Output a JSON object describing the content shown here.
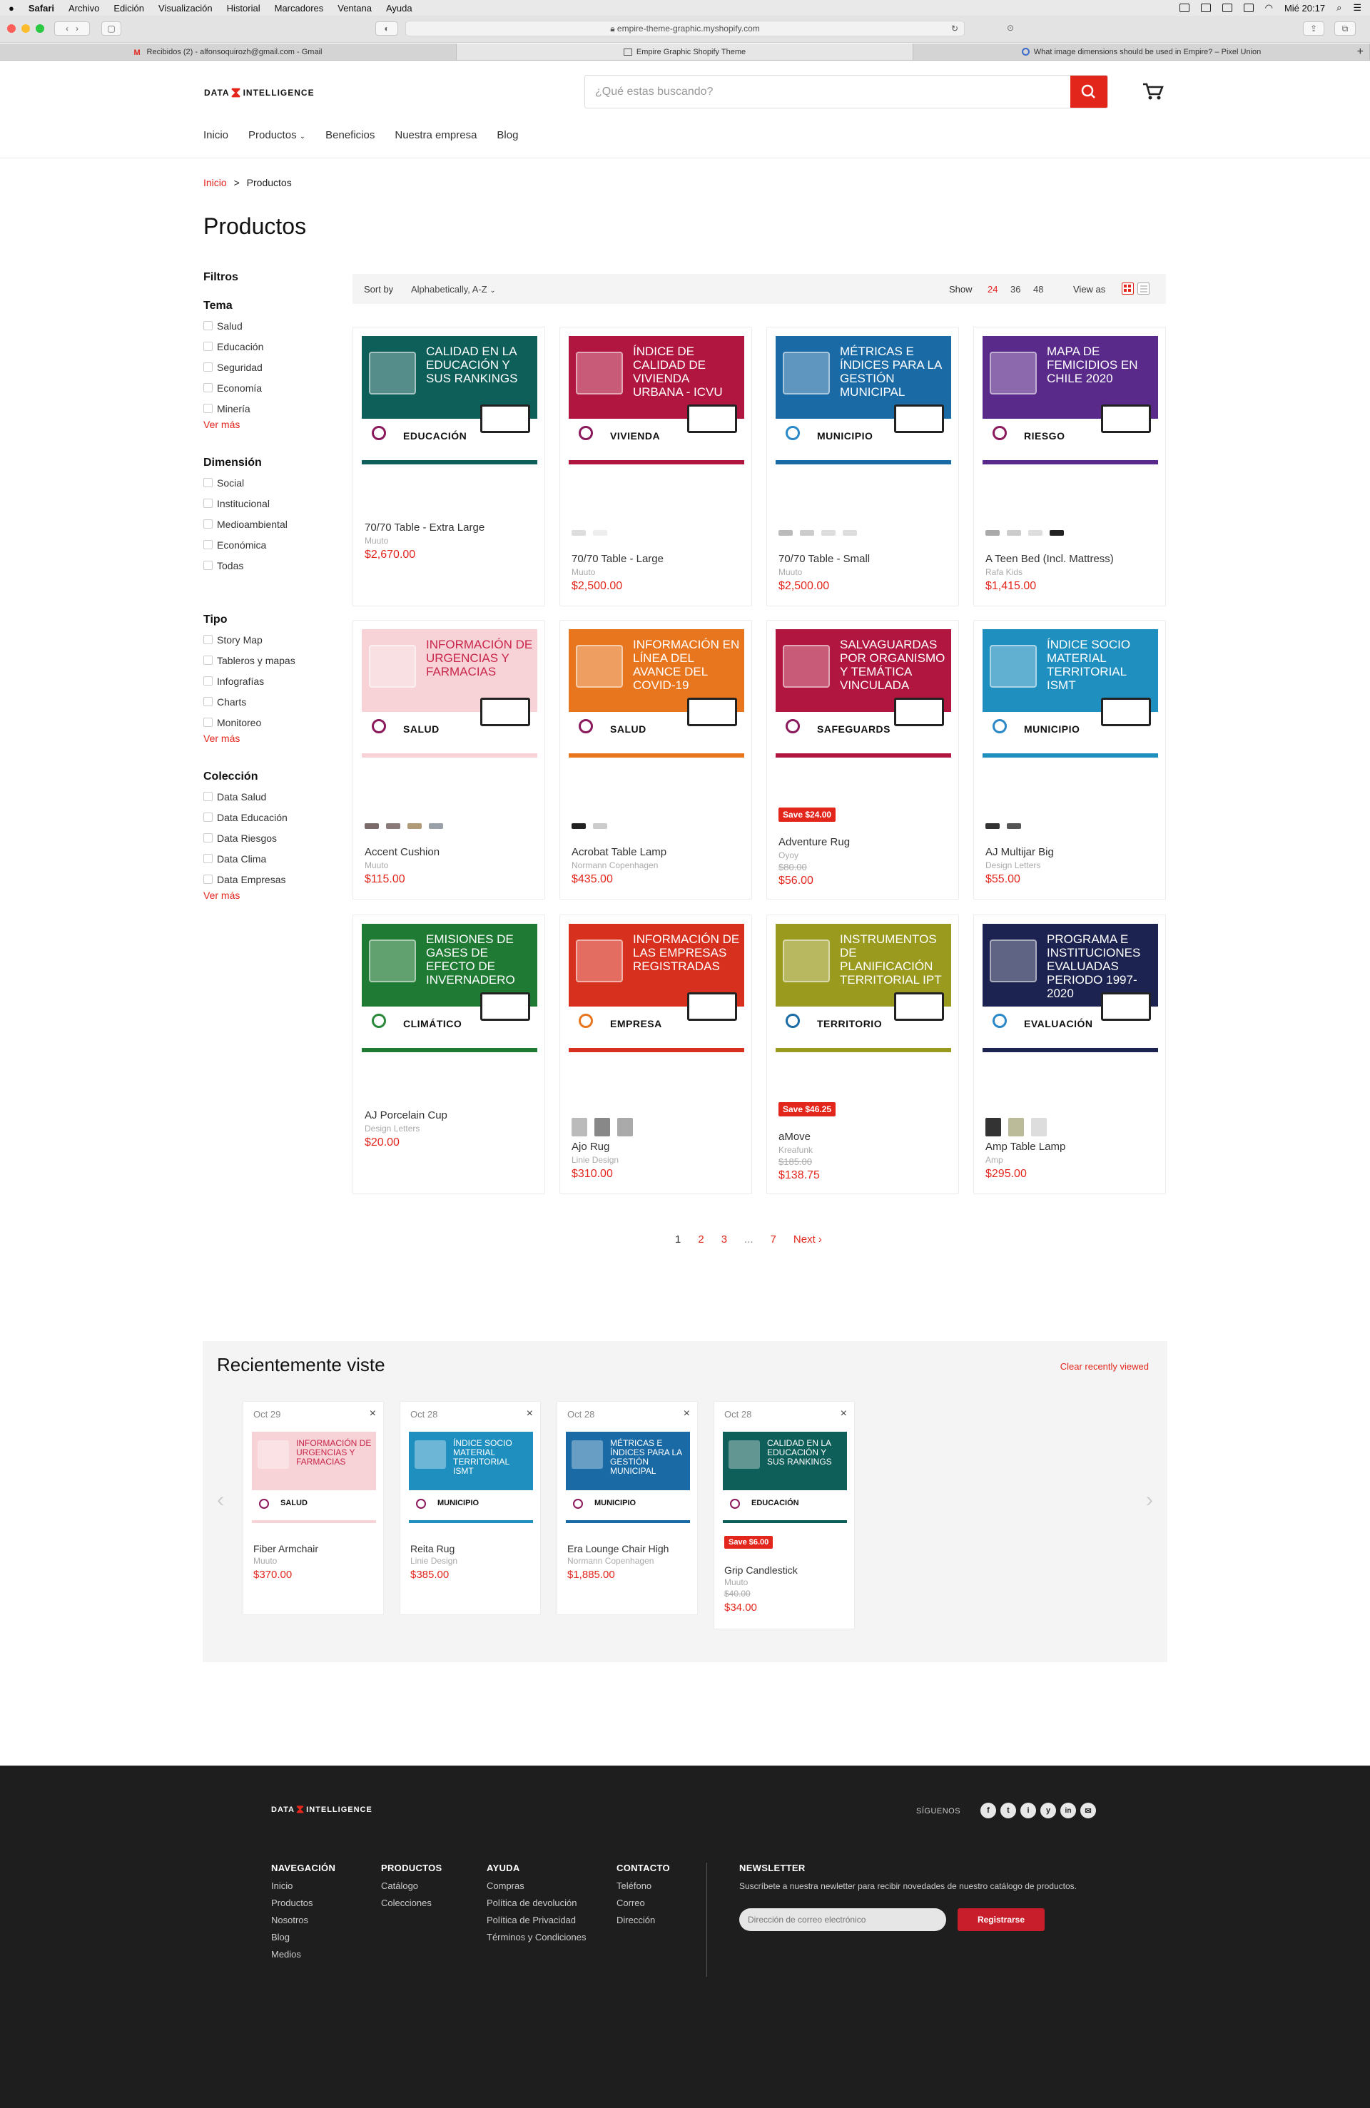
{
  "menubar": {
    "apple": "",
    "items": [
      "Safari",
      "Archivo",
      "Edición",
      "Visualización",
      "Historial",
      "Marcadores",
      "Ventana",
      "Ayuda"
    ],
    "clock": "Mié 20:17"
  },
  "browser": {
    "url": "empire-theme-graphic.myshopify.com",
    "tabs": [
      {
        "label": "Recibidos (2) - alfonsoquirozh@gmail.com - Gmail",
        "icon": "gmail-icon"
      },
      {
        "label": "Empire Graphic Shopify Theme",
        "icon": "shopify-icon"
      },
      {
        "label": "What image dimensions should be used in Empire? – Pixel Union",
        "icon": "pixelunion-icon"
      }
    ]
  },
  "header": {
    "logo_left": "DATA",
    "logo_right": "INTELLIGENCE",
    "search_placeholder": "¿Qué estas buscando?",
    "nav": [
      "Inicio",
      "Productos",
      "Beneficios",
      "Nuestra empresa",
      "Blog"
    ]
  },
  "breadcrumb": {
    "home": "Inicio",
    "sep": ">",
    "current": "Productos"
  },
  "page_title": "Productos",
  "filters": {
    "title": "Filtros",
    "groups": [
      {
        "title": "Tema",
        "items": [
          "Salud",
          "Educación",
          "Seguridad",
          "Economía",
          "Minería"
        ],
        "more": "Ver más"
      },
      {
        "title": "Dimensión",
        "items": [
          "Social",
          "Institucional",
          "Medioambiental",
          "Económica",
          "Todas"
        ],
        "more": ""
      },
      {
        "title": "Tipo",
        "items": [
          "Story Map",
          "Tableros y mapas",
          "Infografías",
          "Charts",
          "Monitoreo"
        ],
        "more": "Ver más"
      },
      {
        "title": "Colección",
        "items": [
          "Data Salud",
          "Data Educación",
          "Data Riesgos",
          "Data Clima",
          "Data Empresas"
        ],
        "more": "Ver más"
      }
    ]
  },
  "sortbar": {
    "sort_label": "Sort by",
    "sort_value": "Alphabetically, A-Z",
    "show_label": "Show",
    "show_options": [
      "24",
      "36",
      "48"
    ],
    "view_label": "View as"
  },
  "products": [
    {
      "title": "Calidad en la educación y sus rankings",
      "category": "EDUCACIÓN",
      "color": "#0e5e5a",
      "accent": "#8a1a5c",
      "name": "70/70 Table - Extra Large",
      "vendor": "Muuto",
      "price": "$2,670.00",
      "compare": "",
      "save": "",
      "swatches": []
    },
    {
      "title": "Índice de calidad de vivienda urbana - ICVU",
      "category": "VIVIENDA",
      "color": "#b0163f",
      "accent": "#8a1a5c",
      "name": "70/70 Table - Large",
      "vendor": "Muuto",
      "price": "$2,500.00",
      "compare": "",
      "save": "",
      "swatches": [
        "#ddd",
        "#eee"
      ]
    },
    {
      "title": "Métricas e índices para la gestión municipal",
      "category": "MUNICIPIO",
      "color": "#1a6aa5",
      "accent": "#2a88c8",
      "name": "70/70 Table - Small",
      "vendor": "Muuto",
      "price": "$2,500.00",
      "compare": "",
      "save": "",
      "swatches": [
        "#bbb",
        "#ccc",
        "#ddd",
        "#ddd"
      ]
    },
    {
      "title": "Mapa de femicidios en Chile 2020",
      "category": "RIESGO",
      "color": "#5a2a8a",
      "accent": "#8a1a5c",
      "name": "A Teen Bed (Incl. Mattress)",
      "vendor": "Rafa Kids",
      "price": "$1,415.00",
      "compare": "",
      "save": "",
      "swatches": [
        "#aaa",
        "#ccc",
        "#ddd",
        "#222"
      ]
    },
    {
      "title": "Información de urgencias y farmacias",
      "category": "SALUD",
      "color": "#f7d3d8",
      "accent": "#8a1a5c",
      "name": "Accent Cushion",
      "vendor": "Muuto",
      "price": "$115.00",
      "compare": "",
      "save": "",
      "swatches": [
        "#7a6a6a",
        "#8a7a7a",
        "#b09a78",
        "#9aa0a8"
      ]
    },
    {
      "title": "Información en línea del avance del COVID-19",
      "category": "SALUD",
      "color": "#e8761e",
      "accent": "#8a1a5c",
      "name": "Acrobat Table Lamp",
      "vendor": "Normann Copenhagen",
      "price": "$435.00",
      "compare": "",
      "save": "",
      "swatches": [
        "#222",
        "#ccc"
      ]
    },
    {
      "title": "Salvaguardas por organismo y temática vinculada",
      "category": "SAFEGUARDS",
      "color": "#b0163f",
      "accent": "#8a1a5c",
      "name": "Adventure Rug",
      "vendor": "Oyoy",
      "price": "$56.00",
      "compare": "$80.00",
      "save": "Save $24.00",
      "swatches": []
    },
    {
      "title": "Índice socio material territorial ISMT",
      "category": "MUNICIPIO",
      "color": "#1f8fbf",
      "accent": "#2a88c8",
      "name": "AJ Multijar Big",
      "vendor": "Design Letters",
      "price": "$55.00",
      "compare": "",
      "save": "",
      "swatches": [
        "#333",
        "#555"
      ]
    },
    {
      "title": "Emisiones de gases de efecto de invernadero",
      "category": "CLIMÁTICO",
      "color": "#1f7a33",
      "accent": "#2a8a3a",
      "name": "AJ Porcelain Cup",
      "vendor": "Design Letters",
      "price": "$20.00",
      "compare": "",
      "save": "",
      "swatches": []
    },
    {
      "title": "Información de las empresas registradas",
      "category": "EMPRESA",
      "color": "#d8301e",
      "accent": "#e8761e",
      "name": "Ajo Rug",
      "vendor": "Linie Design",
      "price": "$310.00",
      "compare": "",
      "save": "",
      "swatches": [
        "#bbb",
        "#888",
        "#aaa"
      ]
    },
    {
      "title": "Instrumentos de planificación territorial IPT",
      "category": "TERRITORIO",
      "color": "#9a9a1e",
      "accent": "#1a6aa5",
      "name": "aMove",
      "vendor": "Kreafunk",
      "price": "$138.75",
      "compare": "$185.00",
      "save": "Save $46.25",
      "swatches": []
    },
    {
      "title": "Programa e instituciones evaluadas periodo 1997-2020",
      "category": "EVALUACIÓN",
      "color": "#1c2350",
      "accent": "#2a88c8",
      "name": "Amp Table Lamp",
      "vendor": "Amp",
      "price": "$295.00",
      "compare": "",
      "save": "",
      "swatches": [
        "#333",
        "#bb9",
        "#ddd"
      ]
    }
  ],
  "pagination": {
    "pages": [
      "1",
      "2",
      "3",
      "...",
      "7"
    ],
    "next": "Next ›"
  },
  "recently": {
    "title": "Recientemente viste",
    "clear": "Clear recently viewed",
    "items": [
      {
        "date": "Oct 29",
        "title": "Información de urgencias y farmacias",
        "category": "SALUD",
        "color": "#f7d3d8",
        "name": "Fiber Armchair",
        "vendor": "Muuto",
        "price": "$370.00",
        "compare": "",
        "save": ""
      },
      {
        "date": "Oct 28",
        "title": "Índice socio material territorial ISMT",
        "category": "MUNICIPIO",
        "color": "#1f8fbf",
        "name": "Reita Rug",
        "vendor": "Linie Design",
        "price": "$385.00",
        "compare": "",
        "save": ""
      },
      {
        "date": "Oct 28",
        "title": "Métricas e índices para la gestión municipal",
        "category": "MUNICIPIO",
        "color": "#1a6aa5",
        "name": "Era Lounge Chair High",
        "vendor": "Normann Copenhagen",
        "price": "$1,885.00",
        "compare": "",
        "save": ""
      },
      {
        "date": "Oct 28",
        "title": "Calidad en la educación y sus rankings",
        "category": "EDUCACIÓN",
        "color": "#0e5e5a",
        "name": "Grip Candlestick",
        "vendor": "Muuto",
        "price": "$34.00",
        "compare": "$40.00",
        "save": "Save $6.00"
      }
    ]
  },
  "footer": {
    "follow": "SÍGUENOS",
    "social": [
      "f",
      "t",
      "i",
      "y",
      "in",
      "✉"
    ],
    "columns": [
      {
        "title": "NAVEGACIÓN",
        "links": [
          "Inicio",
          "Productos",
          "Nosotros",
          "Blog",
          "Medios"
        ]
      },
      {
        "title": "PRODUCTOS",
        "links": [
          "Catálogo",
          "Colecciones"
        ]
      },
      {
        "title": "AYUDA",
        "links": [
          "Compras",
          "Política de devolución",
          "Política de Privacidad",
          "Términos y Condiciones"
        ]
      },
      {
        "title": "CONTACTO",
        "links": [
          "Teléfono",
          "Correo",
          "Dirección"
        ]
      }
    ],
    "newsletter_title": "NEWSLETTER",
    "newsletter_text": "Suscríbete a nuestra newletter para recibir novedades de nuestro catálogo de productos.",
    "email_placeholder": "Dirección de correo electrónico",
    "subscribe": "Registrarse"
  }
}
